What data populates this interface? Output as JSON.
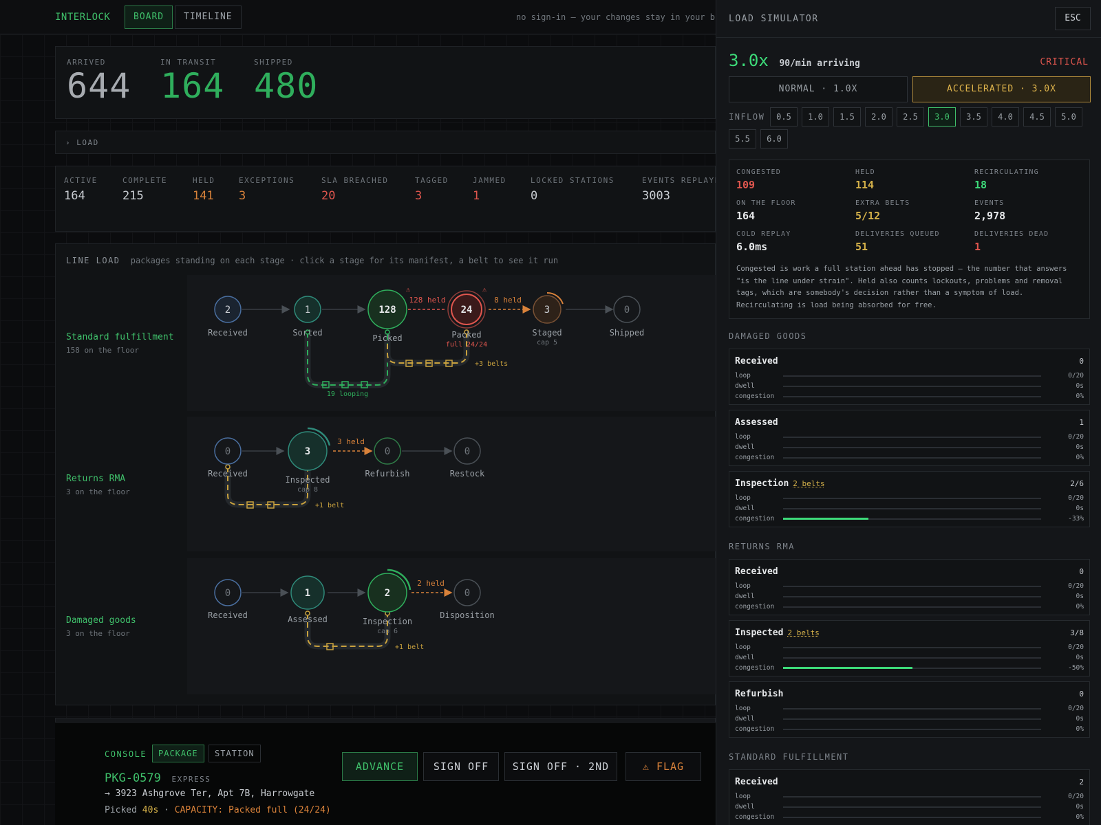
{
  "app": {
    "brand": "INTERLOCK",
    "tabs": [
      "BOARD",
      "TIMELINE"
    ],
    "signin_note": "no sign-in — your changes stay in your browser"
  },
  "totals": [
    {
      "label": "ARRIVED",
      "value": "644"
    },
    {
      "label": "IN TRANSIT",
      "value": "164"
    },
    {
      "label": "SHIPPED",
      "value": "480"
    }
  ],
  "load_toggle": "› LOAD",
  "metrics": [
    {
      "label": "ACTIVE",
      "value": "164"
    },
    {
      "label": "COMPLETE",
      "value": "215"
    },
    {
      "label": "HELD",
      "value": "141"
    },
    {
      "label": "EXCEPTIONS",
      "value": "3"
    },
    {
      "label": "SLA BREACHED",
      "value": "20"
    },
    {
      "label": "TAGGED",
      "value": "3"
    },
    {
      "label": "JAMMED",
      "value": "1"
    },
    {
      "label": "LOCKED STATIONS",
      "value": "0"
    },
    {
      "label": "EVENTS REPLAYED",
      "value": "3003"
    }
  ],
  "line_load": {
    "title": "LINE LOAD",
    "subtitle": "packages standing on each stage · click a stage for its manifest, a belt to see it run",
    "lanes": [
      {
        "name": "Standard fulfillment",
        "sub": "158 on the floor",
        "stations": [
          {
            "label": "Received",
            "count": "2"
          },
          {
            "label": "Sorted",
            "count": "1"
          },
          {
            "label": "Picked",
            "count": "128"
          },
          {
            "label": "Packed",
            "count": "24",
            "note": "full 24/24"
          },
          {
            "label": "Staged",
            "count": "3",
            "note": "cap 5"
          },
          {
            "label": "Shipped",
            "count": "0"
          }
        ],
        "held": [
          "128 held",
          "8 held"
        ],
        "loop_label": "19 looping",
        "belts_label": "+3 belts",
        "warn": "⚠"
      },
      {
        "name": "Returns RMA",
        "sub": "3 on the floor",
        "stations": [
          {
            "label": "Received",
            "count": "0"
          },
          {
            "label": "Inspected",
            "count": "3",
            "note": "cap 8"
          },
          {
            "label": "Refurbish",
            "count": "0"
          },
          {
            "label": "Restock",
            "count": "0"
          }
        ],
        "held": [
          "3 held"
        ],
        "belts_label": "+1 belt"
      },
      {
        "name": "Damaged goods",
        "sub": "3 on the floor",
        "stations": [
          {
            "label": "Received",
            "count": "0"
          },
          {
            "label": "Assessed",
            "count": "1"
          },
          {
            "label": "Inspection",
            "count": "2",
            "note": "cap 6"
          },
          {
            "label": "Disposition",
            "count": "0"
          }
        ],
        "held": [
          "2 held"
        ],
        "belts_label": "+1 belt"
      }
    ]
  },
  "console": {
    "label": "CONSOLE",
    "tabs": [
      "PACKAGE",
      "STATION"
    ],
    "pkg_id": "PKG-0579",
    "pkg_tier": "EXPRESS",
    "address": "→ 3923 Ashgrove Ter, Apt 7B, Harrowgate",
    "status_prefix": "Picked",
    "status_time": "40s",
    "status_sep": "·",
    "status_alert": "CAPACITY: Packed full (24/24)",
    "actions": [
      "ADVANCE",
      "SIGN OFF",
      "SIGN OFF · 2ND",
      "⚠ FLAG"
    ]
  },
  "simulator": {
    "title": "LOAD SIMULATOR",
    "esc": "ESC",
    "multiplier": "3.0x",
    "rate": "90/min arriving",
    "severity": "CRITICAL",
    "modes": [
      "NORMAL · 1.0X",
      "ACCELERATED · 3.0X"
    ],
    "inflow_label": "INFLOW",
    "inflow_options": [
      "0.5",
      "1.0",
      "1.5",
      "2.0",
      "2.5",
      "3.0",
      "3.5",
      "4.0",
      "4.5",
      "5.0",
      "5.5",
      "6.0"
    ],
    "inflow_selected": "3.0",
    "metrics": [
      {
        "label": "CONGESTED",
        "value": "109",
        "color": "#e0564e"
      },
      {
        "label": "HELD",
        "value": "114",
        "color": "#d6b24a"
      },
      {
        "label": "RECIRCULATING",
        "value": "18",
        "color": "#3ddc7a"
      },
      {
        "label": "ON THE FLOOR",
        "value": "164",
        "color": "#e6e8ea"
      },
      {
        "label": "EXTRA BELTS",
        "value": "5/12",
        "color": "#d6b24a"
      },
      {
        "label": "EVENTS",
        "value": "2,978",
        "color": "#e6e8ea"
      },
      {
        "label": "COLD REPLAY",
        "value": "6.0ms",
        "color": "#e6e8ea"
      },
      {
        "label": "DELIVERIES QUEUED",
        "value": "51",
        "color": "#d6b24a"
      },
      {
        "label": "DELIVERIES DEAD",
        "value": "1",
        "color": "#e0564e"
      }
    ],
    "explainer": [
      "Congested is work a full station ahead has stopped — the number that answers",
      "\"is the line under strain\". Held also counts lockouts, problems and removal",
      "tags, which are somebody's decision rather than a symptom of load.",
      "Recirculating is load being absorbed for free."
    ],
    "row_labels": [
      "loop",
      "dwell",
      "congestion"
    ],
    "sections": [
      {
        "title": "DAMAGED GOODS",
        "cards": [
          {
            "name": "Received",
            "count": "0",
            "loop": "0/20",
            "dwell": "0s",
            "congestion": "0%",
            "fill": 0
          },
          {
            "name": "Assessed",
            "count": "1",
            "loop": "0/20",
            "dwell": "0s",
            "congestion": "0%",
            "fill": 0
          },
          {
            "name": "Inspection",
            "belts": "2 belts",
            "count": "2/6",
            "loop": "0/20",
            "dwell": "0s",
            "congestion": "-33%",
            "fill": 33
          }
        ]
      },
      {
        "title": "RETURNS RMA",
        "cards": [
          {
            "name": "Received",
            "count": "0",
            "loop": "0/20",
            "dwell": "0s",
            "congestion": "0%",
            "fill": 0
          },
          {
            "name": "Inspected",
            "belts": "2 belts",
            "count": "3/8",
            "loop": "0/20",
            "dwell": "0s",
            "congestion": "-50%",
            "fill": 50
          },
          {
            "name": "Refurbish",
            "count": "0",
            "loop": "0/20",
            "dwell": "0s",
            "congestion": "0%",
            "fill": 0
          }
        ]
      },
      {
        "title": "STANDARD FULFILLMENT",
        "cards": [
          {
            "name": "Received",
            "count": "2",
            "loop": "0/20",
            "dwell": "0s",
            "congestion": "0%",
            "fill": 0
          }
        ]
      }
    ]
  }
}
